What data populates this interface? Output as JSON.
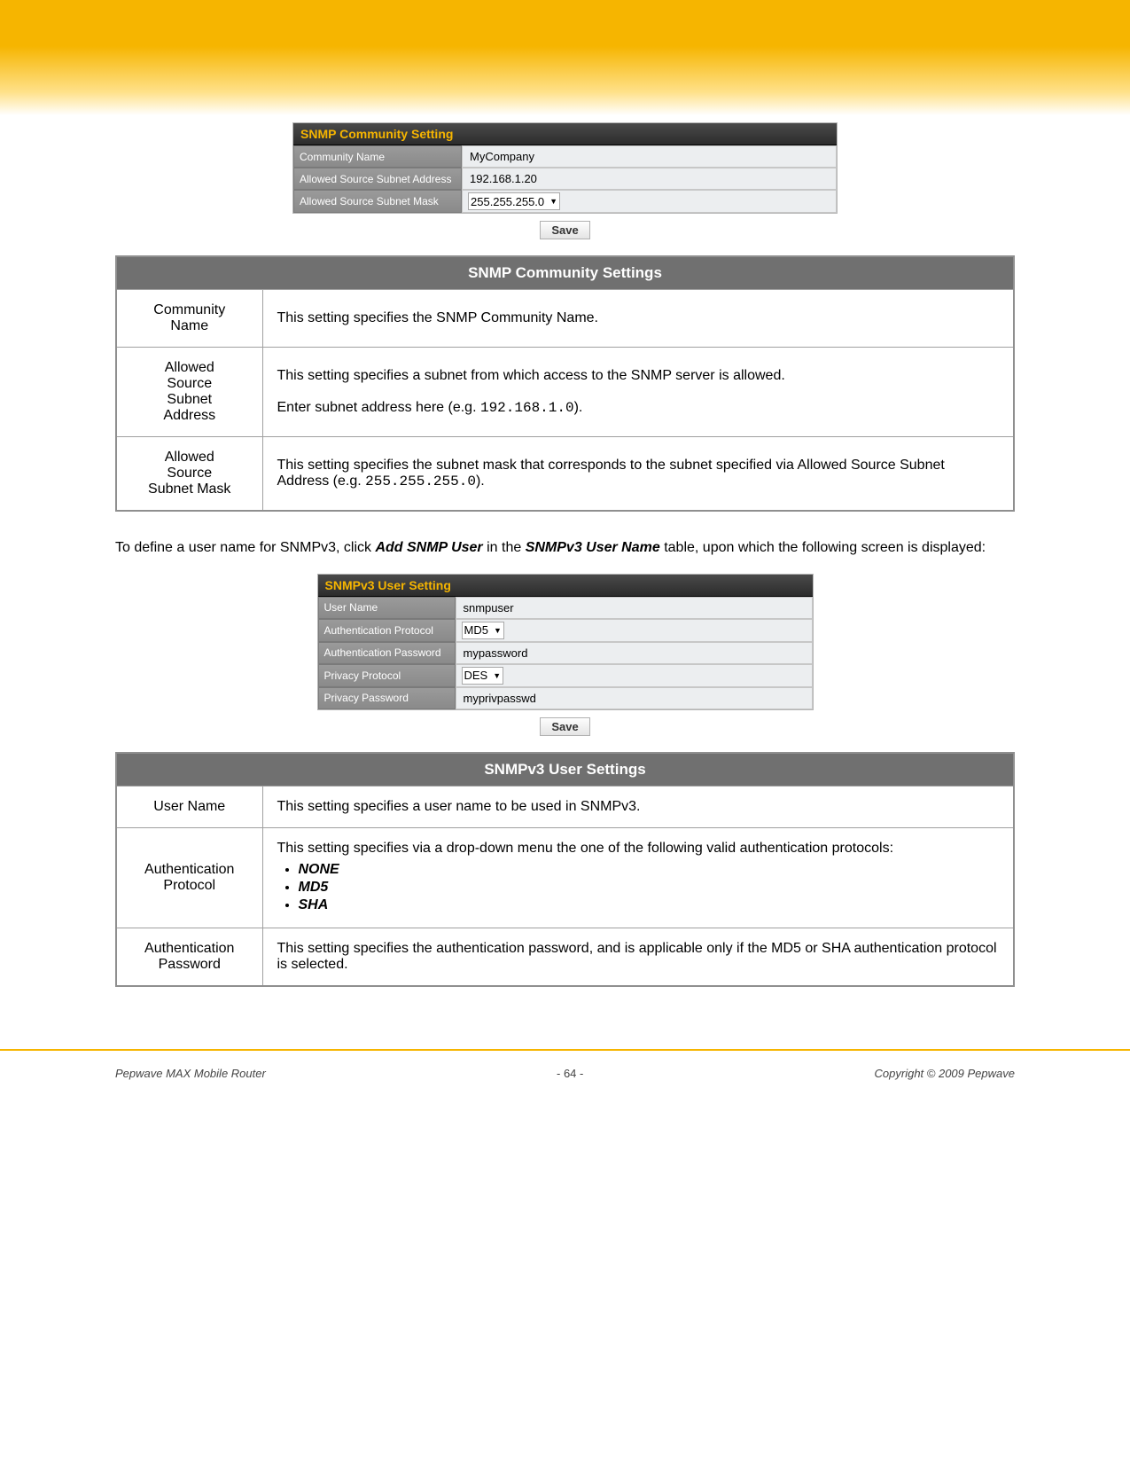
{
  "snmp_community_panel": {
    "title": "SNMP Community Setting",
    "rows": [
      {
        "label": "Community Name",
        "value": "MyCompany",
        "type": "text"
      },
      {
        "label": "Allowed Source Subnet Address",
        "value": "192.168.1.20",
        "type": "text"
      },
      {
        "label": "Allowed Source Subnet Mask",
        "value": "255.255.255.0",
        "type": "select"
      }
    ]
  },
  "save_label": "Save",
  "desc_table1": {
    "header": "SNMP Community Settings",
    "rows": [
      {
        "label": "Community Name",
        "desc_html": "This setting specifies the SNMP Community Name."
      },
      {
        "label": "Allowed Source Subnet Address",
        "desc_html": "This setting specifies a subnet from which access to the SNMP server is allowed.<br><br>Enter subnet address here (e.g. <span class=\"mono\">192.168.1.0</span>)."
      },
      {
        "label": "Allowed Source Subnet Mask",
        "desc_html": "This setting specifies the subnet mask that corresponds to the subnet specified via Allowed Source Subnet Address (e.g. <span class=\"mono\">255.255.255.0</span>).",
        "justify": true
      }
    ]
  },
  "paragraph": "To define a user name for SNMPv3, click <span class=\"bi\">Add SNMP User</span> in the <span class=\"bi\">SNMPv3 User Name</span> table, upon which the following screen is displayed:",
  "snmpv3_panel": {
    "title": "SNMPv3 User Setting",
    "rows": [
      {
        "label": "User Name",
        "value": "snmpuser",
        "type": "text"
      },
      {
        "label": "Authentication Protocol",
        "value": "MD5",
        "type": "select"
      },
      {
        "label": "Authentication Password",
        "value": "mypassword",
        "type": "text"
      },
      {
        "label": "Privacy Protocol",
        "value": "DES",
        "type": "select"
      },
      {
        "label": "Privacy Password",
        "value": "myprivpasswd",
        "type": "text"
      }
    ]
  },
  "desc_table2": {
    "header": "SNMPv3 User Settings",
    "rows": [
      {
        "label": "User Name",
        "desc_html": "This setting specifies a user name to be used in SNMPv3."
      },
      {
        "label": "Authentication Protocol",
        "desc_html": "This setting specifies via a drop-down menu the one of the following valid authentication protocols:<ul class=\"bullets\"><li><span class=\"bi\">NONE</span></li><li><span class=\"bi\">MD5</span></li><li><span class=\"bi\">SHA</span></li></ul>",
        "justify": true
      },
      {
        "label": "Authentication Password",
        "desc_html": "This setting specifies the authentication password, and is applicable only if the MD5 or SHA authentication protocol is selected."
      }
    ]
  },
  "footer": {
    "left": "Pepwave MAX Mobile Router",
    "center": "- 64 -",
    "right": "Copyright © 2009 Pepwave"
  }
}
